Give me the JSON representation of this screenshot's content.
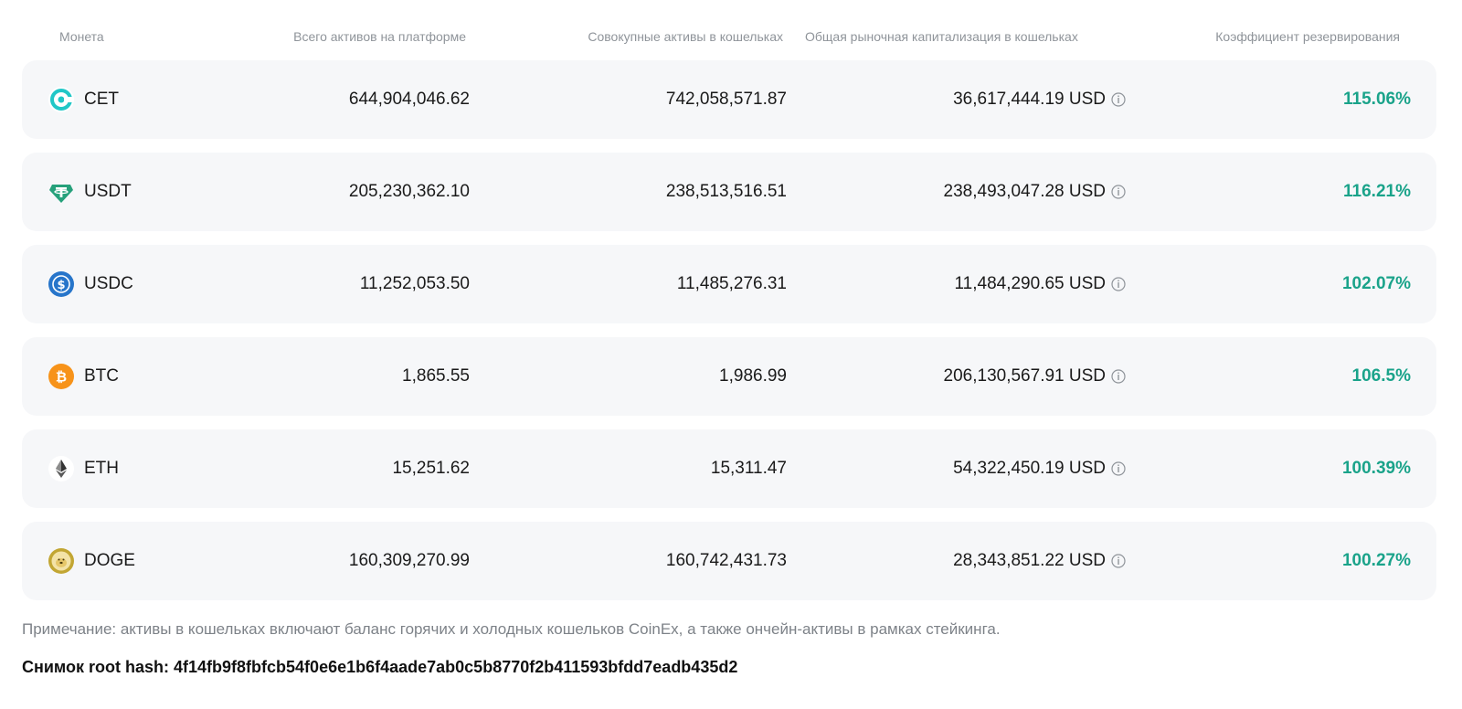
{
  "table": {
    "headers": {
      "coin": "Монета",
      "platform_assets": "Всего активов на платформе",
      "wallet_assets": "Совокупные активы в кошельках",
      "wallet_market_cap": "Общая рыночная капитализация в кошельках",
      "reserve_ratio": "Коэффициент резервирования"
    },
    "rows": [
      {
        "coin": "CET",
        "icon": "cet-icon",
        "platform_assets": "644,904,046.62",
        "wallet_assets": "742,058,571.87",
        "wallet_market_cap": "36,617,444.19 USD",
        "reserve_ratio": "115.06%"
      },
      {
        "coin": "USDT",
        "icon": "usdt-icon",
        "platform_assets": "205,230,362.10",
        "wallet_assets": "238,513,516.51",
        "wallet_market_cap": "238,493,047.28 USD",
        "reserve_ratio": "116.21%"
      },
      {
        "coin": "USDC",
        "icon": "usdc-icon",
        "platform_assets": "11,252,053.50",
        "wallet_assets": "11,485,276.31",
        "wallet_market_cap": "11,484,290.65 USD",
        "reserve_ratio": "102.07%"
      },
      {
        "coin": "BTC",
        "icon": "btc-icon",
        "platform_assets": "1,865.55",
        "wallet_assets": "1,986.99",
        "wallet_market_cap": "206,130,567.91 USD",
        "reserve_ratio": "106.5%"
      },
      {
        "coin": "ETH",
        "icon": "eth-icon",
        "platform_assets": "15,251.62",
        "wallet_assets": "15,311.47",
        "wallet_market_cap": "54,322,450.19 USD",
        "reserve_ratio": "100.39%"
      },
      {
        "coin": "DOGE",
        "icon": "doge-icon",
        "platform_assets": "160,309,270.99",
        "wallet_assets": "160,742,431.73",
        "wallet_market_cap": "28,343,851.22 USD",
        "reserve_ratio": "100.27%"
      }
    ]
  },
  "footer": {
    "note": "Примечание: активы в кошельках включают баланс горячих и холодных кошельков CoinEx, а также ончейн-активы в рамках стейкинга.",
    "root_hash": "Снимок root hash: 4f14fb9f8fbfcb54f0e6e1b6f4aade7ab0c5b8770f2b411593bfdd7eadb435d2"
  },
  "colors": {
    "ratio_green": "#1aa38a",
    "row_bg": "#f6f7f9",
    "header_text": "#8f949a",
    "cet": "#21c7c7",
    "usdt": "#26a17b",
    "usdc": "#2775ca",
    "btc": "#f7931a",
    "eth": "#343434",
    "doge": "#c2a633"
  }
}
